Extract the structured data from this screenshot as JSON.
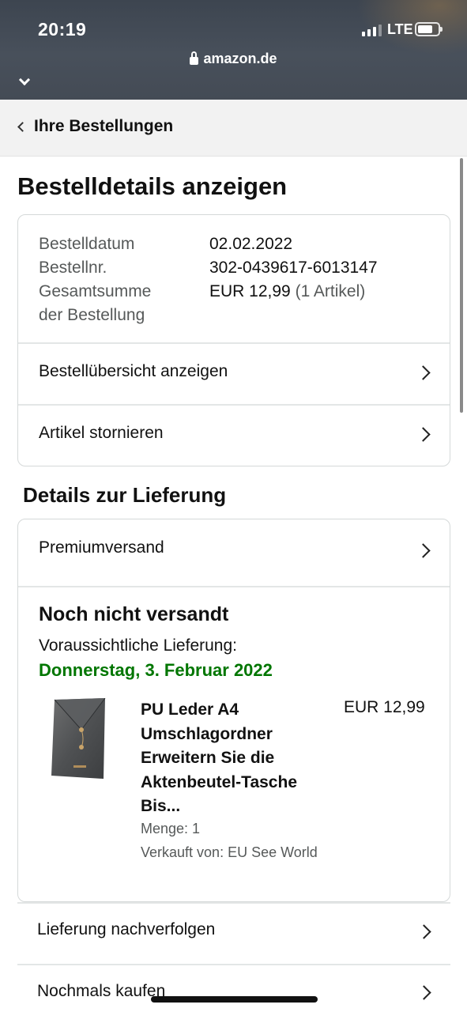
{
  "status_bar": {
    "time": "20:19",
    "network": "LTE",
    "battery_level": 0.75
  },
  "browser": {
    "url": "amazon.de"
  },
  "header": {
    "back_label": "Ihre Bestellungen"
  },
  "page": {
    "title": "Bestelldetails anzeigen"
  },
  "order_summary": {
    "date_label": "Bestelldatum",
    "date_value": "02.02.2022",
    "number_label": "Bestellnr.",
    "number_value": "302-0439617-6013147",
    "total_label_line1": "Gesamtsumme",
    "total_label_line2": "der Bestellung",
    "total_value": "EUR 12,99",
    "total_items": "(1 Artikel)"
  },
  "order_actions": [
    {
      "label": "Bestellübersicht anzeigen"
    },
    {
      "label": "Artikel stornieren"
    }
  ],
  "delivery": {
    "section_title": "Details zur Lieferung",
    "shipping_method": "Premiumversand",
    "status": "Noch nicht versandt",
    "eta_label": "Voraussichtliche Lieferung:",
    "eta_date": "Donnerstag, 3. Februar 2022",
    "status_color": "#007600"
  },
  "item": {
    "title_lines": [
      "PU Leder A4",
      "Umschlagordner",
      "Erweitern Sie die",
      "Aktenbeutel-Tasche",
      "Bis..."
    ],
    "price": "EUR 12,99",
    "quantity": "Menge: 1",
    "seller": "Verkauft von: EU See World"
  },
  "bottom_actions": [
    {
      "label": "Lieferung nachverfolgen"
    },
    {
      "label": "Nochmals kaufen"
    }
  ]
}
